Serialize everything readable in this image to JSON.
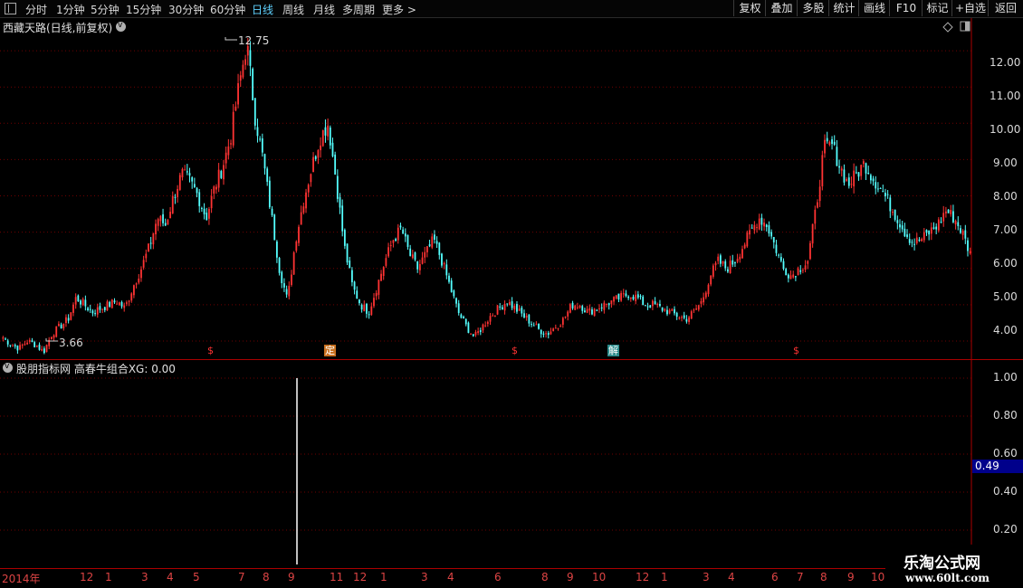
{
  "toolbar": {
    "left": [
      "分时",
      "1分钟",
      "5分钟",
      "15分钟",
      "30分钟",
      "60分钟",
      "日线",
      "周线",
      "月线",
      "多周期",
      "更多 >"
    ],
    "active_index": 6,
    "right": [
      "复权",
      "叠加",
      "多股",
      "统计",
      "画线",
      "F10",
      "标记",
      "+自选",
      "返回"
    ]
  },
  "main_panel": {
    "title": "西藏天路(日线,前复权)",
    "max_label": "12.75",
    "min_label": "3.66",
    "y_ticks": [
      "12.00",
      "11.00",
      "10.00",
      "9.00",
      "8.00",
      "7.00",
      "6.00",
      "5.00",
      "4.00"
    ],
    "markers": [
      {
        "label": "$",
        "style": "dollar"
      },
      {
        "label": "定",
        "style": "ding"
      },
      {
        "label": "$",
        "style": "dollar"
      },
      {
        "label": "解",
        "style": "jie"
      },
      {
        "label": "$",
        "style": "dollar"
      }
    ]
  },
  "indicator_panel": {
    "title": "股朋指标网  高春牛组合XG: 0.00",
    "y_ticks": [
      "1.00",
      "0.80",
      "0.60",
      "0.40",
      "0.20"
    ],
    "current_value": "0.49"
  },
  "x_axis": {
    "labels": [
      "2014年",
      "12",
      "1",
      "3",
      "4",
      "5",
      "7",
      "8",
      "9",
      "11",
      "12",
      "1",
      "3",
      "4",
      "6",
      "8",
      "9",
      "10",
      "12",
      "1",
      "3",
      "4",
      "6",
      "7",
      "8",
      "9",
      "10"
    ]
  },
  "watermark": {
    "line1": "乐淘公式网",
    "line2": "www.60lt.com"
  },
  "colors": {
    "up": "#ff3333",
    "down": "#54ffff",
    "grid": "#8b0000",
    "axis_text": "#d44"
  },
  "chart_data": {
    "type": "candlestick",
    "y_range": [
      3.5,
      12.9
    ],
    "series_close": [
      4.1,
      3.9,
      3.8,
      4.0,
      3.9,
      3.7,
      4.2,
      4.4,
      4.6,
      5.2,
      5.0,
      4.8,
      4.9,
      5.0,
      5.1,
      4.9,
      5.5,
      6.0,
      6.6,
      7.4,
      7.2,
      8.0,
      8.6,
      8.4,
      8.0,
      7.4,
      8.2,
      8.8,
      9.6,
      11.0,
      12.2,
      10.2,
      9.0,
      7.5,
      6.0,
      5.1,
      6.8,
      7.9,
      8.8,
      9.6,
      10.0,
      8.4,
      6.6,
      5.5,
      5.0,
      4.8,
      5.5,
      6.2,
      6.8,
      7.1,
      6.4,
      6.0,
      6.4,
      6.8,
      6.2,
      5.5,
      4.8,
      4.4,
      4.1,
      4.4,
      4.7,
      4.9,
      5.1,
      4.9,
      4.7,
      4.5,
      4.3,
      4.2,
      4.4,
      4.6,
      5.0,
      5.0,
      4.8,
      4.9,
      5.0,
      5.1,
      5.2,
      5.3,
      5.2,
      5.0,
      5.0,
      4.9,
      4.8,
      4.7,
      4.6,
      4.8,
      5.1,
      5.8,
      6.2,
      6.0,
      6.2,
      6.6,
      7.0,
      7.4,
      7.2,
      6.6,
      6.0,
      5.8,
      6.0,
      6.2,
      7.6,
      9.3,
      9.4,
      8.8,
      8.3,
      8.6,
      8.9,
      8.5,
      8.2,
      7.8,
      7.4,
      7.0,
      6.7,
      6.8,
      7.0,
      7.2,
      7.6,
      7.4,
      7.0,
      6.4
    ],
    "indicator": {
      "spike_value": 1.0,
      "spike_index": 127,
      "total_bars": 400
    }
  }
}
